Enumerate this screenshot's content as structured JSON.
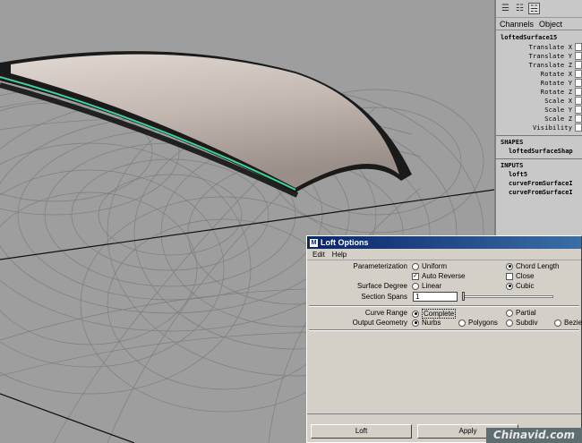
{
  "channel_box": {
    "toolbar_icons": [
      "channel-box-icon",
      "layer-editor-icon",
      "attribute-layout-icon"
    ],
    "menu": [
      "Channels",
      "Object"
    ],
    "node_name": "loftedSurface15",
    "attributes": [
      {
        "label": "Translate X"
      },
      {
        "label": "Translate Y"
      },
      {
        "label": "Translate Z"
      },
      {
        "label": "Rotate X"
      },
      {
        "label": "Rotate Y"
      },
      {
        "label": "Rotate Z"
      },
      {
        "label": "Scale X"
      },
      {
        "label": "Scale Y"
      },
      {
        "label": "Scale Z"
      },
      {
        "label": "Visibility"
      }
    ],
    "shapes_header": "SHAPES",
    "shape_name": "loftedSurfaceShap",
    "inputs_header": "INPUTS",
    "inputs": [
      "loft5",
      "curveFromSurfaceI",
      "curveFromSurfaceI"
    ]
  },
  "dialog": {
    "title": "Loft Options",
    "menu": [
      "Edit",
      "Help"
    ],
    "parameterization_label": "Parameterization",
    "param_uniform": "Uniform",
    "param_chord": "Chord Length",
    "auto_reverse": "Auto Reverse",
    "close": "Close",
    "surface_degree_label": "Surface Degree",
    "degree_linear": "Linear",
    "degree_cubic": "Cubic",
    "section_spans_label": "Section Spans",
    "section_spans_value": "1",
    "curve_range_label": "Curve Range",
    "range_complete": "Complete",
    "range_partial": "Partial",
    "output_geometry_label": "Output Geometry",
    "geo_nurbs": "Nurbs",
    "geo_polygons": "Polygons",
    "geo_subdiv": "Subdiv",
    "geo_bezier": "Bezier",
    "loft_button": "Loft",
    "apply_button": "Apply"
  },
  "watermark": "Chinavid.com",
  "colors": {
    "viewport_bg": "#9e9e9e",
    "surface": "#c9bfb8",
    "selection_edge": "#3fcf9a",
    "title_bar": "#0a246a"
  }
}
